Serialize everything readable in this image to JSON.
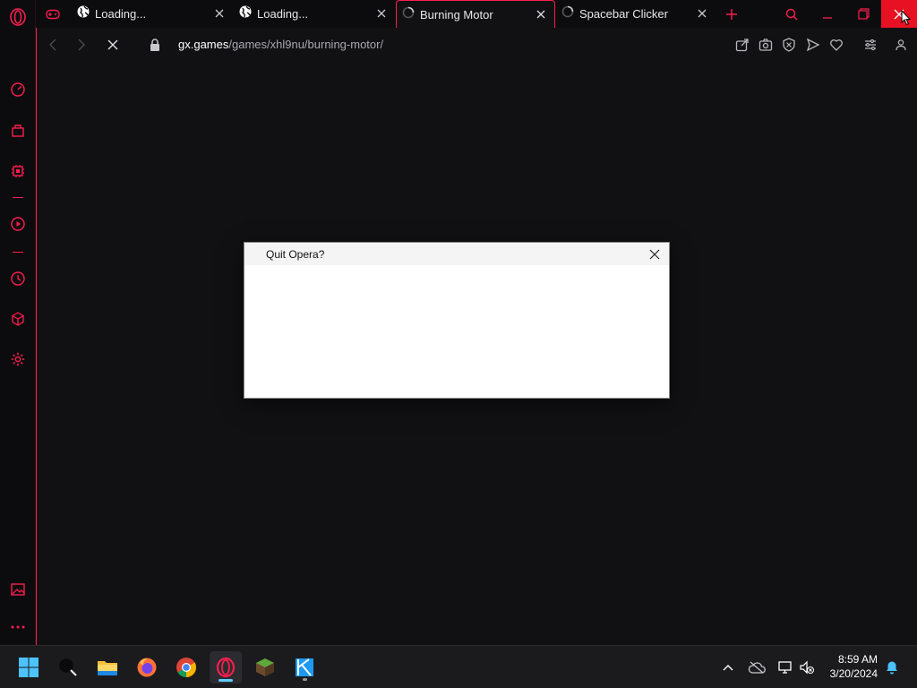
{
  "colors": {
    "accent": "#fa1e4e",
    "background": "#111113",
    "taskbar": "#1b1b1d"
  },
  "tabs": [
    {
      "title": "Loading...",
      "icon": "globe-icon",
      "active": false
    },
    {
      "title": "Loading...",
      "icon": "globe-icon",
      "active": false
    },
    {
      "title": "Burning Motor",
      "icon": "spinner-icon",
      "active": true
    },
    {
      "title": "Spacebar Clicker",
      "icon": "spinner-icon",
      "active": false
    }
  ],
  "address": {
    "host": "gx.games",
    "path": "/games/xhl9nu/burning-motor/"
  },
  "dialog": {
    "title": "Quit Opera?"
  },
  "clock": {
    "time": "8:59 AM",
    "date": "3/20/2024"
  }
}
